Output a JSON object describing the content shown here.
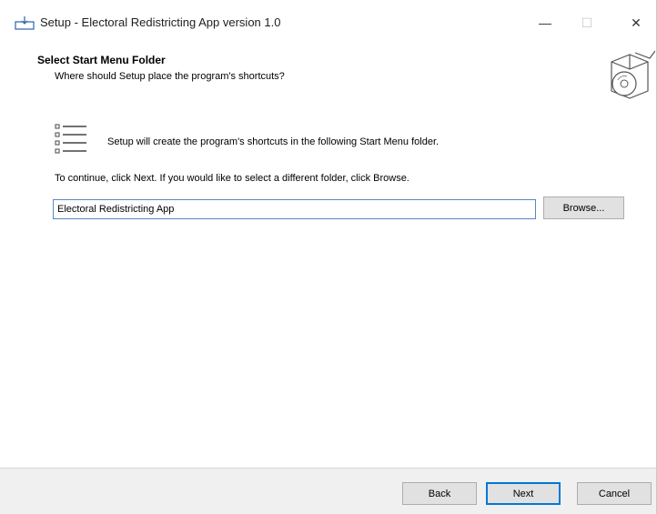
{
  "window": {
    "title": "Setup - Electoral Redistricting App version 1.0",
    "minimize_glyph": "—",
    "maximize_glyph": "☐",
    "close_glyph": "✕"
  },
  "header": {
    "title": "Select Start Menu Folder",
    "subtitle": "Where should Setup place the program's shortcuts?",
    "graphic_icon": "setup-box-cd-icon"
  },
  "content": {
    "list_icon": "start-menu-list-icon",
    "info_text": "Setup will create the program's shortcuts in the following Start Menu folder.",
    "instruction_text": "To continue, click Next. If you would like to select a different folder, click Browse.",
    "folder_value": "Electoral Redistricting App",
    "browse_label": "Browse..."
  },
  "footer": {
    "back_label": "Back",
    "next_label": "Next",
    "cancel_label": "Cancel"
  },
  "colors": {
    "accent": "#0078d7",
    "input_border": "#5a86c7",
    "footer_bg": "#f0f0f0",
    "button_bg": "#e1e1e1"
  }
}
